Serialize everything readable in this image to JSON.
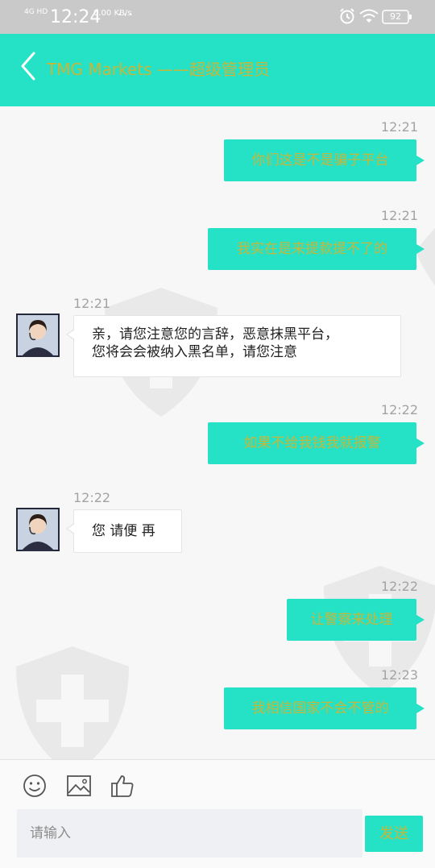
{
  "status_bar": {
    "network": "4G HD",
    "time": "12:24",
    "speed": "0.00 KB/s",
    "dots": "···",
    "battery": "92",
    "icons": [
      "alarm-icon",
      "wifi-icon",
      "battery-icon"
    ]
  },
  "header": {
    "back_icon": "chevron-left-icon",
    "title": "TMG Markets ——超级管理员"
  },
  "messages": [
    {
      "side": "out",
      "time": "12:21",
      "text": "你们这是不是骗子平台"
    },
    {
      "side": "out",
      "time": "12:21",
      "text": "我实在是来提款提不了的"
    },
    {
      "side": "in",
      "time": "12:21",
      "lines": [
        "亲，请您注意您的言辞，恶意抹黑平台，",
        "您将会会被纳入黑名单，请您注意"
      ]
    },
    {
      "side": "out",
      "time": "12:22",
      "text": "如果不给我钱我就报警"
    },
    {
      "side": "in",
      "time": "12:22",
      "lines": [
        "您 请便 再"
      ]
    },
    {
      "side": "out",
      "time": "12:22",
      "text": "让警察来处理"
    },
    {
      "side": "out",
      "time": "12:23",
      "text": "我相信国家不会不管的"
    }
  ],
  "toolbar": {
    "icons": [
      "emoji-icon",
      "image-icon",
      "thumbs-up-icon"
    ],
    "input_placeholder": "请输入",
    "send_label": "发送"
  },
  "colors": {
    "accent": "#25e2c6",
    "accent_text": "#c6b73a",
    "status_bar": "#c9c9c9",
    "chat_bg": "#f7f7f7"
  }
}
